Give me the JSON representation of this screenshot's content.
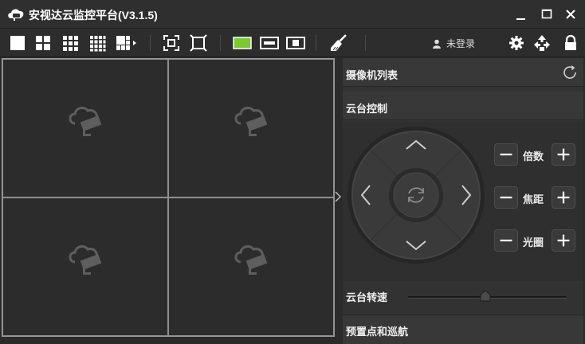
{
  "app": {
    "title": "安视达云监控平台(V3.1.5)",
    "icon": "cloud-camera-icon"
  },
  "window_controls": {
    "minimize": "minimize-icon",
    "maximize": "maximize-icon",
    "close": "close-icon"
  },
  "toolbar": {
    "layout_buttons": [
      "layout-1x1-icon",
      "layout-2x2-icon",
      "layout-3x3-icon",
      "layout-4x4-icon",
      "layout-more-icon"
    ],
    "view_buttons": [
      "fit-screen-icon",
      "fullscreen-icon"
    ],
    "aspect_buttons": [
      "aspect-fill-icon",
      "aspect-wide-icon",
      "aspect-original-icon"
    ],
    "active_color": "#7cc832",
    "clean_button": "broom-icon",
    "user_label": "未登录",
    "right_icons": [
      "settings-icon",
      "network-icon",
      "lock-icon"
    ]
  },
  "video_grid": {
    "cells": 4,
    "placeholder_icon": "cloud-camera-icon"
  },
  "panel": {
    "camera_list_title": "摄像机列表",
    "ptz_title": "云台控制",
    "controls": [
      {
        "label": "倍数"
      },
      {
        "label": "焦距"
      },
      {
        "label": "光圈"
      }
    ],
    "speed_label": "云台转速",
    "speed_value": 0.5,
    "preset_title": "预置点和巡航"
  }
}
